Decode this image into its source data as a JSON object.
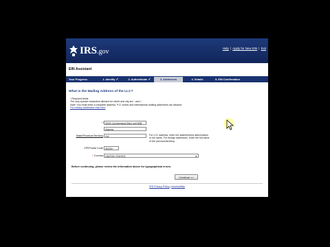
{
  "header": {
    "logo_text": "IRS",
    "logo_suffix": ".gov",
    "links": [
      "Help",
      "Apply for New EIN",
      "Exit"
    ],
    "separator": "|"
  },
  "title": "EIN Assistant",
  "progress": {
    "label": "Your Progress:",
    "steps": [
      {
        "label": "1. Identify",
        "done": true
      },
      {
        "label": "2. Authenticate",
        "done": true
      },
      {
        "label": "3. Addresses",
        "active": true
      },
      {
        "label": "4. Details"
      },
      {
        "label": "5. EIN Confirmation"
      }
    ],
    "check": "✓"
  },
  "question": "What is the Mailing Address of the LLC?",
  "notes": {
    "required": "Required fields",
    "line1": "The only special characters allowed for street and city are - and /.",
    "line2": "Note: You must enter a complete address. P.O. boxes and international mailing addresses are allowed.",
    "link": "For military addresses click here"
  },
  "form": {
    "street_label": "Street",
    "street_value": "3205 Cumberland Blvd unit 838",
    "city_label": "City",
    "city_value": "Atlanta",
    "state_label": "State/Province/Territory",
    "state_value": "GA",
    "zip_label": "ZIP/Postal Code",
    "zip_value": "30339",
    "country_label": "Country",
    "country_value": "UNITED STATES",
    "req_mark": "*",
    "help_line1": "For U.S. address, enter the state/territory abbreviation",
    "help_line2": "or full name. For foreign addresses, enter the full name",
    "help_line3": "of the province/territory."
  },
  "before_text": "Before continuing, please review the information above for typographical errors.",
  "continue_label": "Continue >>",
  "footer": {
    "privacy": "IRS Privacy Policy",
    "sep": "|",
    "access": "Accessibility"
  }
}
